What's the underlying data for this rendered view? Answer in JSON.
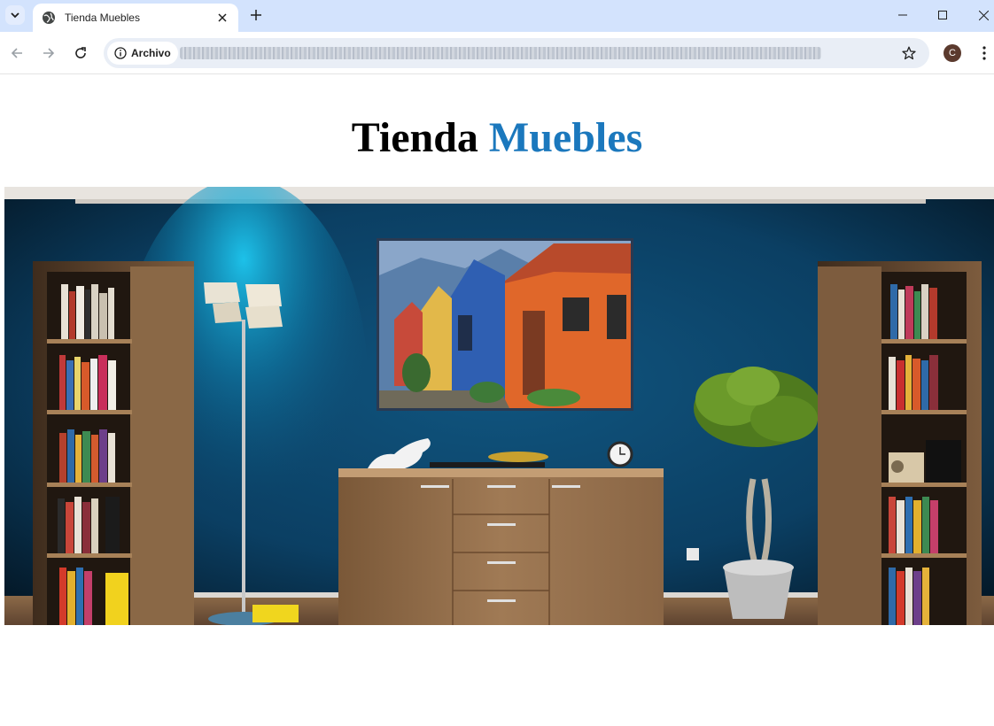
{
  "browser": {
    "tab_title": "Tienda Muebles",
    "site_info_label": "Archivo",
    "profile_initial": "C"
  },
  "page": {
    "heading_word_1": "Tienda",
    "heading_word_2": "Muebles",
    "accent_color": "#1b78bd",
    "hero_image_alt": "Sala con pared azul, estanterías de libros, cómoda de madera, lámpara de pie y planta"
  },
  "icons": [
    "tab-search-icon",
    "globe-icon",
    "close-icon",
    "plus-icon",
    "minimize-icon",
    "maximize-icon",
    "window-close-icon",
    "back-arrow-icon",
    "forward-arrow-icon",
    "reload-icon",
    "info-icon",
    "star-icon",
    "more-vert-icon"
  ]
}
